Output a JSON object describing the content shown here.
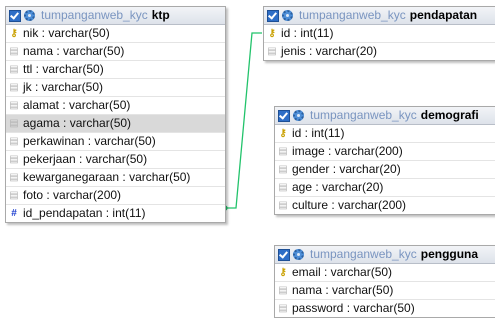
{
  "tables": [
    {
      "schema": "tumpanganweb_kyc",
      "name": "ktp",
      "columns": [
        {
          "text": "nik : varchar(50)",
          "icon": "key-icon"
        },
        {
          "text": "nama : varchar(50)",
          "icon": "column-icon"
        },
        {
          "text": "ttl : varchar(50)",
          "icon": "column-icon"
        },
        {
          "text": "jk : varchar(50)",
          "icon": "column-icon"
        },
        {
          "text": "alamat : varchar(50)",
          "icon": "column-icon"
        },
        {
          "text": "agama : varchar(50)",
          "icon": "column-icon",
          "highlighted": true
        },
        {
          "text": "perkawinan : varchar(50)",
          "icon": "column-icon"
        },
        {
          "text": "pekerjaan : varchar(50)",
          "icon": "column-icon"
        },
        {
          "text": "kewarganegaraan : varchar(50)",
          "icon": "column-icon"
        },
        {
          "text": "foto : varchar(200)",
          "icon": "column-icon"
        },
        {
          "text": "id_pendapatan : int(11)",
          "icon": "index-icon"
        }
      ]
    },
    {
      "schema": "tumpanganweb_kyc",
      "name": "pendapatan",
      "columns": [
        {
          "text": "id : int(11)",
          "icon": "key-icon"
        },
        {
          "text": "jenis : varchar(20)",
          "icon": "column-icon"
        }
      ]
    },
    {
      "schema": "tumpanganweb_kyc",
      "name": "demografi",
      "columns": [
        {
          "text": "id : int(11)",
          "icon": "key-icon"
        },
        {
          "text": "image : varchar(200)",
          "icon": "column-icon"
        },
        {
          "text": "gender : varchar(20)",
          "icon": "column-icon"
        },
        {
          "text": "age : varchar(20)",
          "icon": "column-icon"
        },
        {
          "text": "culture : varchar(200)",
          "icon": "column-icon"
        }
      ]
    },
    {
      "schema": "tumpanganweb_kyc",
      "name": "pengguna",
      "columns": [
        {
          "text": "email : varchar(50)",
          "icon": "key-icon"
        },
        {
          "text": "nama : varchar(50)",
          "icon": "column-icon"
        },
        {
          "text": "password : varchar(50)",
          "icon": "column-icon"
        }
      ]
    }
  ],
  "relations": [
    {
      "from": "ktp.id_pendapatan",
      "to": "pendapatan.id",
      "color": "#22c36b"
    }
  ],
  "colors": {
    "schema_text": "#7a95c0",
    "key_icon": "#c9a000",
    "index_icon": "#1e3fd0",
    "highlight_row": "#d9d9d9"
  }
}
